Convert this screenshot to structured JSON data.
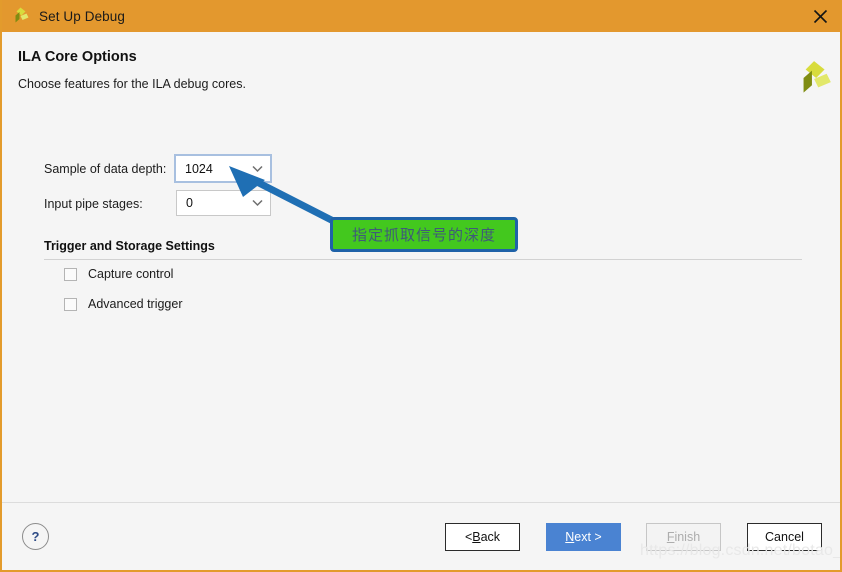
{
  "window": {
    "title": "Set Up Debug",
    "close_icon": "close-icon",
    "logo_icon": "xilinx-logo-icon",
    "titlebar_color": "#e3982e",
    "background_color": "#f5f5f5"
  },
  "header": {
    "title": "ILA Core Options",
    "subtitle": "Choose features for the ILA debug cores.",
    "logo_icon": "xilinx-logo-icon"
  },
  "fields": [
    {
      "label": "Sample of data depth:",
      "value": "1024",
      "focused": true,
      "chevron_icon": "chevron-down-icon"
    },
    {
      "label": "Input pipe stages:",
      "value": "0",
      "focused": false,
      "chevron_icon": "chevron-down-icon"
    }
  ],
  "section": {
    "title": "Trigger and Storage Settings",
    "checkboxes": [
      {
        "label": "Capture control",
        "checked": false
      },
      {
        "label": "Advanced trigger",
        "checked": false
      }
    ]
  },
  "annotation": {
    "text": "指定抓取信号的深度",
    "fill_color": "#43c81e",
    "border_color": "#1f62a8",
    "text_color": "#3f5a79",
    "arrow_color": "#1f6fb4"
  },
  "footer": {
    "help_label": "?",
    "buttons": [
      {
        "name": "back",
        "prefix": "< ",
        "accel": "B",
        "suffix": "ack",
        "style": "normal"
      },
      {
        "name": "next",
        "prefix": "",
        "accel": "N",
        "suffix": "ext >",
        "style": "primary"
      },
      {
        "name": "finish",
        "prefix": "",
        "accel": "F",
        "suffix": "inish",
        "style": "disabled"
      },
      {
        "name": "cancel",
        "prefix": "",
        "accel": "",
        "suffix": "Cancel",
        "style": "normal"
      }
    ],
    "watermark": "https://blog.csdn.net/botao_li"
  }
}
